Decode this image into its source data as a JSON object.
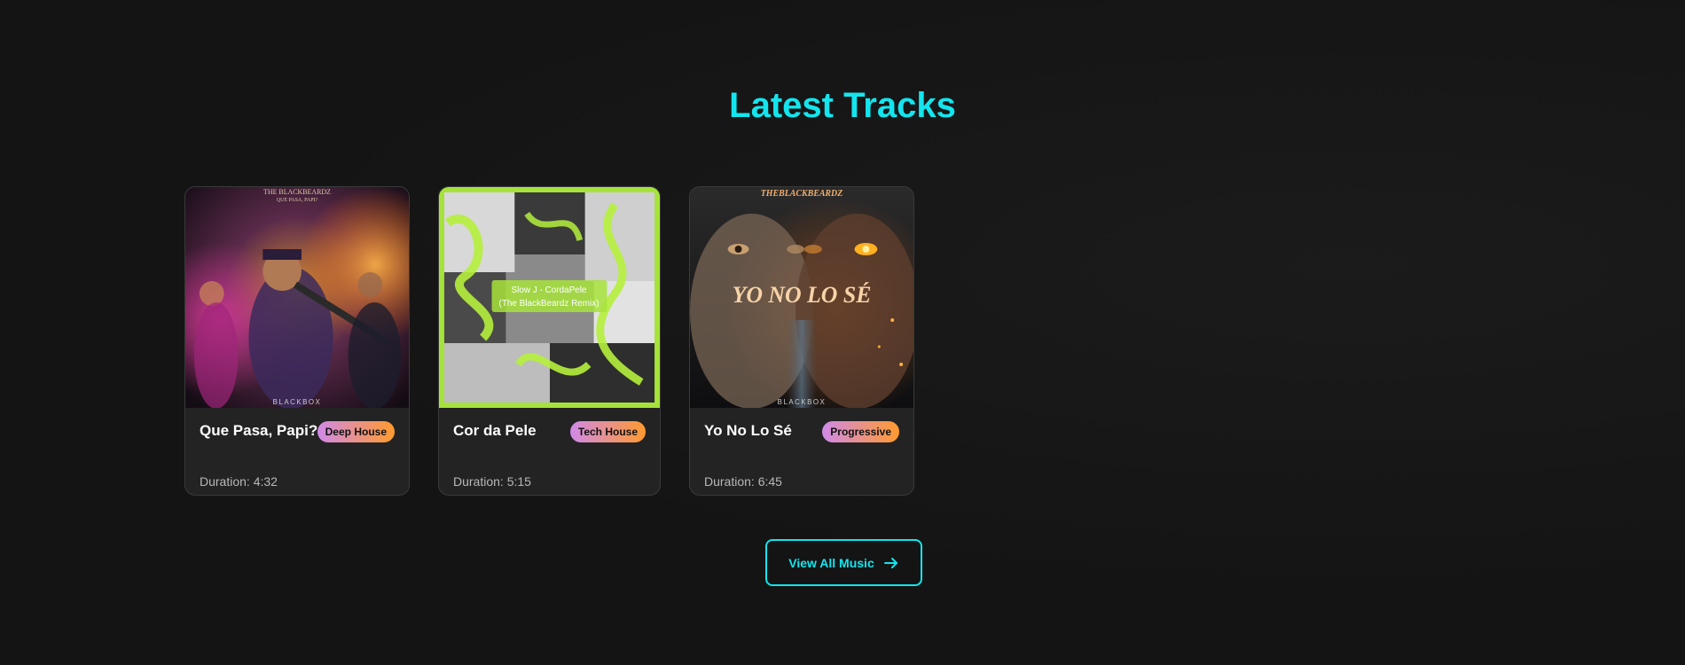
{
  "section": {
    "title": "Latest Tracks"
  },
  "tracks": [
    {
      "title": "Que Pasa, Papi?",
      "genre": "Deep House",
      "duration": "Duration: 4:32",
      "art_top_text": "THE BLACKBEARDZ",
      "art_sub_text": "QUE PASA, PAPI?",
      "art_bottom_text": "BLACKBOX"
    },
    {
      "title": "Cor da Pele",
      "genre": "Tech House",
      "duration": "Duration: 5:15",
      "art_line1": "Slow J - CordaPele",
      "art_line2": "(The BlackBeardz Remix)"
    },
    {
      "title": "Yo No Lo Sé",
      "genre": "Progressive",
      "duration": "Duration: 6:45",
      "art_top_text": "THEBLACKBEARDZ",
      "art_center_text": "YO NO LO SÉ",
      "art_bottom_text": "BLACKBOX"
    }
  ],
  "cta": {
    "label": "View All Music",
    "icon": "arrow-right-icon"
  },
  "colors": {
    "accent": "#13e5ee",
    "background": "#141414",
    "card": "#232323",
    "badge_gradient_start": "#d08ae8",
    "badge_gradient_end": "#ff9a2e"
  }
}
